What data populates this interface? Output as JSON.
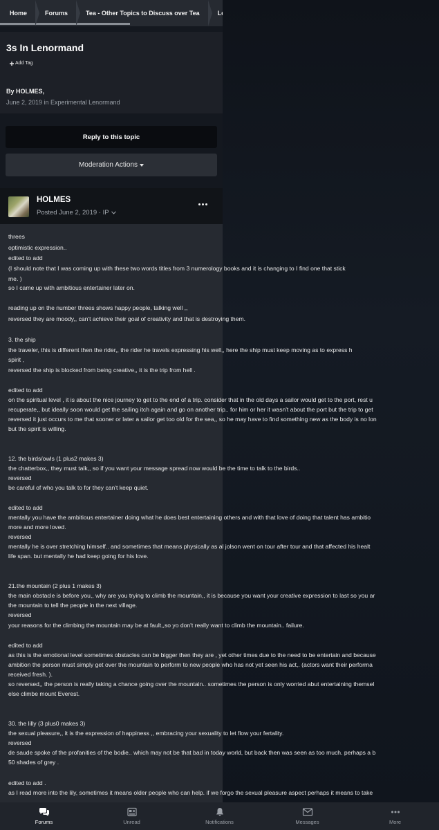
{
  "breadcrumb": {
    "items": [
      "Home",
      "Forums",
      "Tea - Other Topics to Discuss over Tea",
      "Lenorm"
    ]
  },
  "topic": {
    "title": "3s In Lenormand",
    "add_tag": "Add Tag",
    "byline": "By HOLMES,",
    "dateline": "June 2, 2019 in Experimental Lenormand"
  },
  "actions": {
    "reply": "Reply to this topic",
    "moderation": "Moderation Actions"
  },
  "post": {
    "author": "HOLMES",
    "posted": "Posted June 2, 2019 · IP",
    "lines": [
      "threes",
      "optimistic expression..",
      "edited to add",
      "(I should note that I was coming up with these two words titles from 3 numerology books and it is changing to I find one that stick",
      "me. )",
      "so I came up with ambitious entertainer later on.",
      "reading up on the number threes shows happy people, talking well ,,",
      "reversed they are moody,, can't achieve their goal of creativity and that is destroying them.",
      "3. the ship",
      "the traveler, this is different then the rider,, the rider he travels expressing his well,, here the ship must keep moving as to express h",
      "spirit ,",
      "reversed the ship is blocked from being creative,, it is the trip from hell .",
      "edited to add",
      "on the spiritual level , it is about the nice journey to get to the end of a trip. consider that in the old days a sailor would get to the port, rest u",
      "recuperate,, but ideally soon would get the sailing itch again and go on another trip.. for him or her it wasn't about the port but the trip to get",
      "reversed it just occurs to me that sooner or later a sailor get too old for the sea,, so he may have to find something new as the body is no lon",
      "but the spirit is willing.",
      "12. the birds/owls (1 plus2 makes 3)",
      "the chatterbox,, they must talk,, so if you want your message spread now would be the time to talk to the birds..",
      "reversed",
      "be careful of who you talk to for they can't keep quiet.",
      "edited to add",
      "mentally you have the ambitious entertainer doing what he does best entertaining others and with that love of doing that talent has ambitio",
      "more and more loved.",
      "reversed",
      "mentally he is over stretching himself.. and sometimes that means physically as al jolson went on tour after tour and that affected his healt",
      "life span. but mentally he had keep going for his love.",
      "21.the mountain (2 plus 1 makes 3)",
      "the main obstacle is before you,, why are you trying to climb the mountain,, it is because you want your creative expression to last so you ar",
      "the mountain to tell the people in the next village.",
      "reversed",
      "your reasons for the climbing the mountain may be at fault,,so yo don't really want to climb the mountain.. failure.",
      "edited to add",
      "as this is the emotional level sometimes obstacles can be bigger then they are , yet other times due to the need to be entertain and because",
      "ambition the person must simply get over the mountain to perform to new people who has not yet seen his act,. (actors want their performa",
      "received fresh. ).",
      "so reversed,, the person is really taking a chance going over the mountain.. sometimes the person is only worried abut entertaining themsel",
      "else climbe mount Everest.",
      "30. the lilly (3 plus0 makes 3)",
      "the sexual pleasure,, it is the expression of happiness ,, embracing your sexuality to let flow your fertality.",
      "reversed",
      "de saude spoke of the profanities of the bodie.. which may not be that bad in today world, but back then was seen as too much. perhaps a b",
      "50 shades of grey .",
      "edited to add .",
      "as I read more into the lily, sometimes it means older people who can help. if we forgo the sexual pleasure aspect perhaps it means to take"
    ]
  },
  "bottom_nav": {
    "items": [
      "Forums",
      "Unread",
      "Notifications",
      "Messages",
      "More"
    ]
  }
}
